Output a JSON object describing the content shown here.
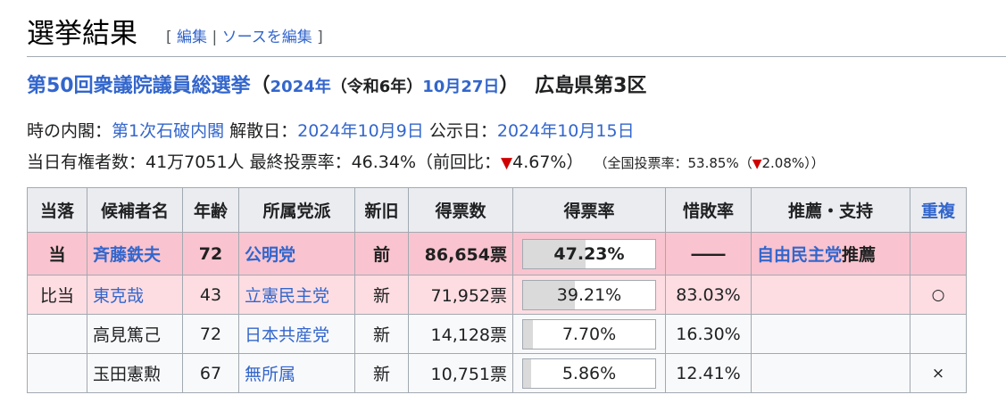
{
  "section": {
    "title": "選挙結果",
    "edit_open": "[ ",
    "edit": "編集",
    "edit_sep": " | ",
    "edit_source": "ソースを編集",
    "edit_close": " ]"
  },
  "election": {
    "name": "第50回衆議院議員総選挙",
    "paren_open": "（",
    "year": "2024年",
    "era": "（令和6年）",
    "date": "10月27日",
    "paren_close": "）",
    "district": "広島県第3区"
  },
  "info": {
    "cabinet_label": "時の内閣：",
    "cabinet": "第1次石破内閣",
    "dissolution_label": "解散日：",
    "dissolution": "2024年10月9日",
    "announce_label": "公示日：",
    "announce": "2024年10月15日",
    "voters_label": "当日有権者数：41万7051人 最終投票率：46.34%（前回比：",
    "turnout_change_mark": "▼",
    "turnout_change": "4.67%）",
    "national_label": "（全国投票率：53.85%（",
    "national_change_mark": "▼",
    "national_change": "2.08%））"
  },
  "table": {
    "headers": [
      "当落",
      "候補者名",
      "年齢",
      "所属党派",
      "新旧",
      "得票数",
      "得票率",
      "惜敗率",
      "推薦・支持",
      "重複"
    ],
    "rows": [
      {
        "result": "当",
        "name": "斉藤鉄夫",
        "age": "72",
        "party": "公明党",
        "status": "前",
        "votes": "86,654票",
        "share": 47.23,
        "share_text": "47.23%",
        "sekihai": "――",
        "endorse_party": "自由民主党",
        "endorse_suffix": "推薦",
        "dup": ""
      },
      {
        "result": "比当",
        "name": "東克哉",
        "age": "43",
        "party": "立憲民主党",
        "status": "新",
        "votes": "71,952票",
        "share": 39.21,
        "share_text": "39.21%",
        "sekihai": "83.03%",
        "endorse_party": "",
        "endorse_suffix": "",
        "dup": "○"
      },
      {
        "result": "",
        "name": "高見篤己",
        "age": "72",
        "party": "日本共産党",
        "status": "新",
        "votes": "14,128票",
        "share": 7.7,
        "share_text": "7.70%",
        "sekihai": "16.30%",
        "endorse_party": "",
        "endorse_suffix": "",
        "dup": ""
      },
      {
        "result": "",
        "name": "玉田憲勲",
        "age": "67",
        "party": "無所属",
        "status": "新",
        "votes": "10,751票",
        "share": 5.86,
        "share_text": "5.86%",
        "sekihai": "12.41%",
        "endorse_party": "",
        "endorse_suffix": "",
        "dup": "×"
      }
    ]
  }
}
